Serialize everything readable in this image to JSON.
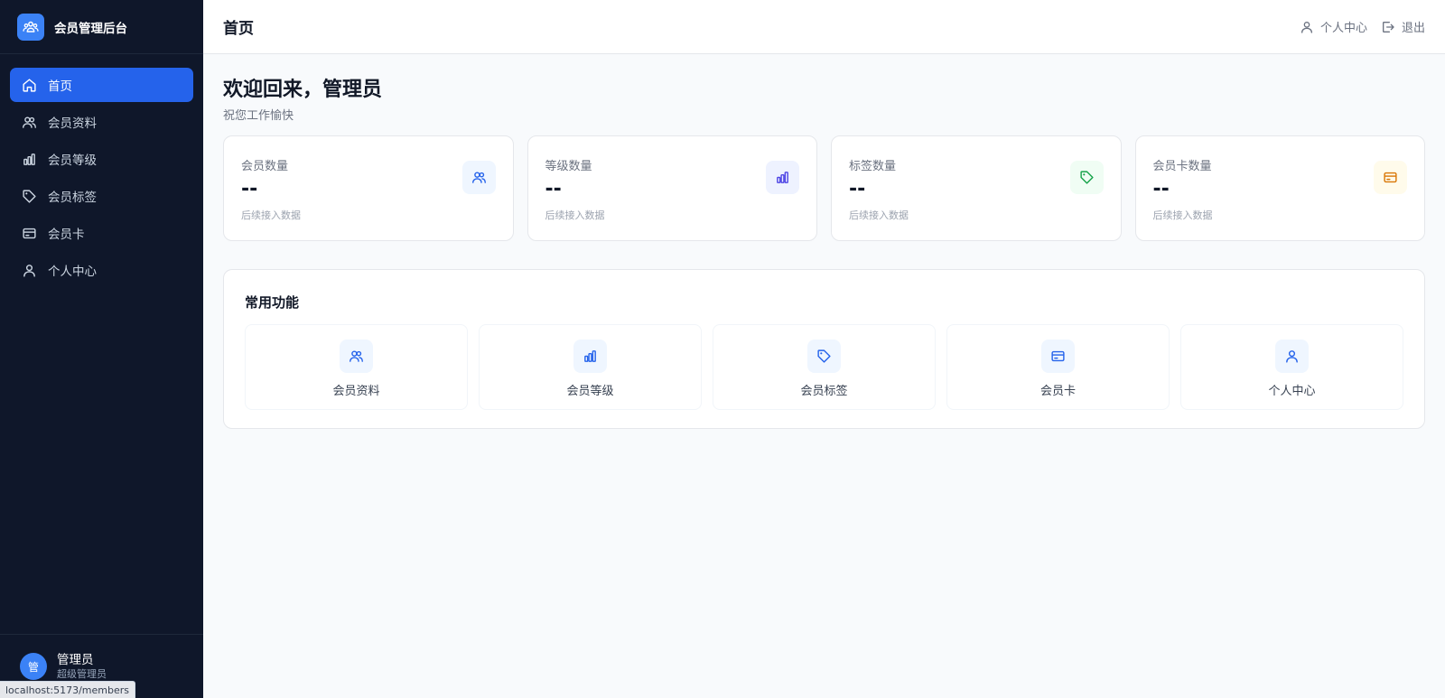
{
  "brand": {
    "title": "会员管理后台"
  },
  "sidebar": {
    "items": [
      {
        "label": "首页",
        "icon": "home-icon",
        "active": true
      },
      {
        "label": "会员资料",
        "icon": "users-icon"
      },
      {
        "label": "会员等级",
        "icon": "bar-chart-icon"
      },
      {
        "label": "会员标签",
        "icon": "tag-icon"
      },
      {
        "label": "会员卡",
        "icon": "card-icon"
      },
      {
        "label": "个人中心",
        "icon": "user-icon"
      }
    ],
    "user": {
      "avatar_text": "管",
      "name": "管理员",
      "role": "超级管理员"
    }
  },
  "status_url": "localhost:5173/members",
  "header": {
    "title": "首页",
    "profile_label": "个人中心",
    "logout_label": "退出"
  },
  "welcome": {
    "title": "欢迎回来，管理员",
    "subtitle": "祝您工作愉快"
  },
  "stats": [
    {
      "label": "会员数量",
      "value": "--",
      "note": "后续接入数据",
      "icon": "users-icon",
      "color": "#2563eb",
      "bg": "#eff6ff"
    },
    {
      "label": "等级数量",
      "value": "--",
      "note": "后续接入数据",
      "icon": "bar-chart-icon",
      "color": "#4f46e5",
      "bg": "#eef2ff"
    },
    {
      "label": "标签数量",
      "value": "--",
      "note": "后续接入数据",
      "icon": "tag-icon",
      "color": "#16a34a",
      "bg": "#f0fdf4"
    },
    {
      "label": "会员卡数量",
      "value": "--",
      "note": "后续接入数据",
      "icon": "card-icon",
      "color": "#d97706",
      "bg": "#fffbeb"
    }
  ],
  "quick": {
    "title": "常用功能",
    "items": [
      {
        "label": "会员资料",
        "icon": "users-icon"
      },
      {
        "label": "会员等级",
        "icon": "bar-chart-icon"
      },
      {
        "label": "会员标签",
        "icon": "tag-icon"
      },
      {
        "label": "会员卡",
        "icon": "card-icon"
      },
      {
        "label": "个人中心",
        "icon": "user-icon"
      }
    ]
  },
  "colors": {
    "sidebar_bg": "#0f172a",
    "accent": "#2563eb"
  }
}
